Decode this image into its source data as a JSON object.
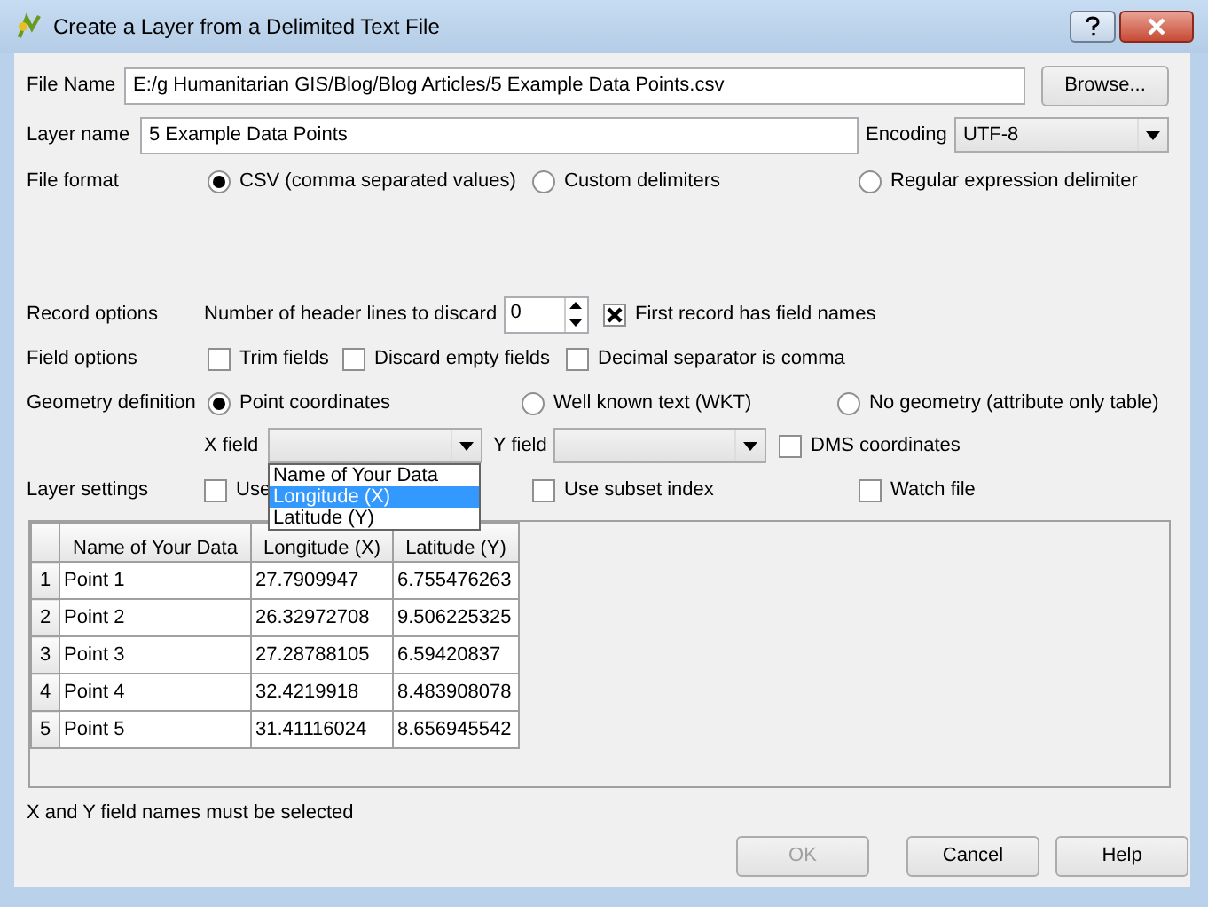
{
  "window": {
    "title": "Create a Layer from a Delimited Text File"
  },
  "file_name": {
    "label": "File Name",
    "value": "E:/g Humanitarian GIS/Blog/Blog Articles/5 Example Data Points.csv",
    "browse": "Browse..."
  },
  "layer_name": {
    "label": "Layer name",
    "value": "5 Example Data Points"
  },
  "encoding": {
    "label": "Encoding",
    "value": "UTF-8"
  },
  "file_format": {
    "label": "File format",
    "options": [
      {
        "label": "CSV (comma separated values)",
        "selected": true
      },
      {
        "label": "Custom delimiters",
        "selected": false
      },
      {
        "label": "Regular expression delimiter",
        "selected": false
      }
    ]
  },
  "record_options": {
    "label": "Record options",
    "header_lines_label": "Number of header lines to discard",
    "header_lines_value": "0",
    "first_record": {
      "label": "First record has field names",
      "checked": true
    }
  },
  "field_options": {
    "label": "Field options",
    "options": [
      {
        "label": "Trim fields",
        "checked": false
      },
      {
        "label": "Discard empty fields",
        "checked": false
      },
      {
        "label": "Decimal separator is comma",
        "checked": false
      }
    ]
  },
  "geometry": {
    "label": "Geometry definition",
    "options": [
      {
        "label": "Point coordinates",
        "selected": true
      },
      {
        "label": "Well known text (WKT)",
        "selected": false
      },
      {
        "label": "No geometry (attribute only table)",
        "selected": false
      }
    ]
  },
  "x_field": {
    "label": "X field"
  },
  "y_field": {
    "label": "Y field"
  },
  "dms": {
    "label": "DMS coordinates",
    "checked": false
  },
  "layer_settings": {
    "label": "Layer settings",
    "options": [
      {
        "label": "Use",
        "checked": false
      },
      {
        "label": "Use subset index",
        "checked": false
      },
      {
        "label": "Watch file",
        "checked": false
      }
    ]
  },
  "x_field_dropdown": {
    "items": [
      {
        "label": "Name of Your Data",
        "selected": false
      },
      {
        "label": "Longitude (X)",
        "selected": true
      },
      {
        "label": "Latitude (Y)",
        "selected": false
      }
    ]
  },
  "table": {
    "columns": [
      "Name of Your Data",
      "Longitude (X)",
      "Latitude (Y)"
    ],
    "rows": [
      {
        "number": "1",
        "cells": [
          "Point 1",
          "27.7909947",
          "6.755476263"
        ]
      },
      {
        "number": "2",
        "cells": [
          "Point 2",
          "26.32972708",
          "9.506225325"
        ]
      },
      {
        "number": "3",
        "cells": [
          "Point 3",
          "27.28788105",
          "6.59420837"
        ]
      },
      {
        "number": "4",
        "cells": [
          "Point 4",
          "32.4219918",
          "8.483908078"
        ]
      },
      {
        "number": "5",
        "cells": [
          "Point 5",
          "31.41116024",
          "8.656945542"
        ]
      }
    ]
  },
  "status": "X and Y field names must be selected",
  "buttons": [
    {
      "label": "OK",
      "disabled": true
    },
    {
      "label": "Cancel",
      "disabled": false
    },
    {
      "label": "Help",
      "disabled": false
    }
  ]
}
